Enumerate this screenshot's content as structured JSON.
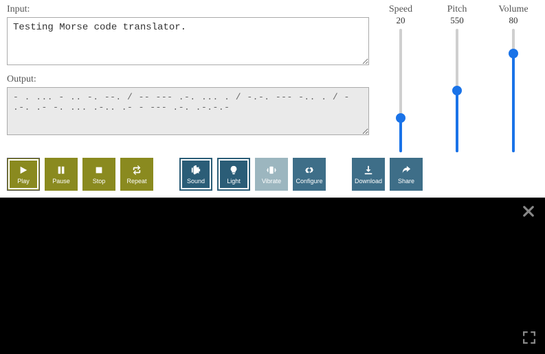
{
  "io": {
    "input_label": "Input:",
    "input_value": "Testing Morse code translator.",
    "output_label": "Output:",
    "output_value": "- . ... - .. -. --. / -- --- .-. ... . / -.-. --- -.. . / - .-. .- -. ... .-.. .- - --- .-. .-.-.-"
  },
  "sliders": {
    "speed": {
      "label": "Speed",
      "value": "20",
      "percent": 28
    },
    "pitch": {
      "label": "Pitch",
      "value": "550",
      "percent": 50
    },
    "volume": {
      "label": "Volume",
      "value": "80",
      "percent": 80
    }
  },
  "buttons": {
    "play": "Play",
    "pause": "Pause",
    "stop": "Stop",
    "repeat": "Repeat",
    "sound": "Sound",
    "light": "Light",
    "vibrate": "Vibrate",
    "configure": "Configure",
    "download": "Download",
    "share": "Share"
  }
}
